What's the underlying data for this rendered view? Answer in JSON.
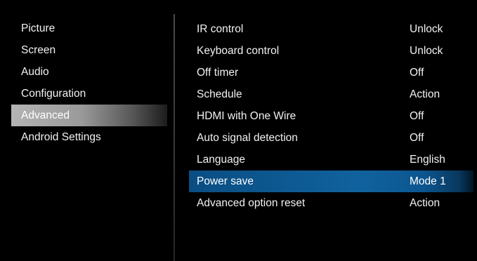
{
  "left_menu": {
    "items": [
      {
        "label": "Picture"
      },
      {
        "label": "Screen"
      },
      {
        "label": "Audio"
      },
      {
        "label": "Configuration"
      },
      {
        "label": "Advanced",
        "active": true
      },
      {
        "label": "Android Settings"
      }
    ]
  },
  "settings": {
    "rows": [
      {
        "label": "IR control",
        "value": "Unlock"
      },
      {
        "label": "Keyboard control",
        "value": "Unlock"
      },
      {
        "label": "Off timer",
        "value": "Off"
      },
      {
        "label": "Schedule",
        "value": "Action"
      },
      {
        "label": "HDMI with One Wire",
        "value": "Off"
      },
      {
        "label": "Auto signal detection",
        "value": "Off"
      },
      {
        "label": "Language",
        "value": "English"
      },
      {
        "label": "Power save",
        "value": "Mode 1",
        "selected": true
      },
      {
        "label": "Advanced option reset",
        "value": "Action"
      }
    ]
  },
  "colors": {
    "background": "#000000",
    "text": "#f2f2f2",
    "active_category_highlight": "#9a9a9a",
    "selected_row_highlight": "#10629e"
  }
}
